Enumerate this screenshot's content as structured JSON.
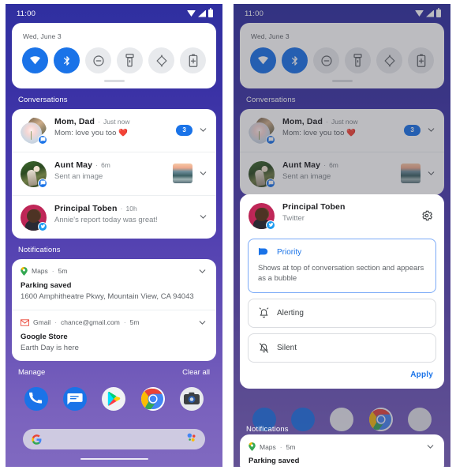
{
  "status_bar": {
    "time": "11:00",
    "icons": [
      "wifi-icon",
      "signal-icon",
      "battery-icon"
    ]
  },
  "quick_settings": {
    "date": "Wed, June 3",
    "tiles": [
      {
        "name": "wifi",
        "label": "Wi-Fi",
        "active": true
      },
      {
        "name": "bluetooth",
        "label": "Bluetooth",
        "active": true
      },
      {
        "name": "dnd",
        "label": "Do Not Disturb",
        "active": false
      },
      {
        "name": "flashlight",
        "label": "Flashlight",
        "active": false
      },
      {
        "name": "auto-rotate",
        "label": "Auto-rotate",
        "active": false
      },
      {
        "name": "battery-saver",
        "label": "Battery Saver",
        "active": false
      }
    ]
  },
  "sections": {
    "conversations": "Conversations",
    "notifications": "Notifications"
  },
  "conversations": [
    {
      "name": "Mom, Dad",
      "separator": "·",
      "time": "Just now",
      "message": "Mom: love you too ❤️",
      "count": "3",
      "badge": "messages-icon",
      "chevron": "chevron-down-icon"
    },
    {
      "name": "Aunt May",
      "separator": "·",
      "time": "6m",
      "message": "Sent an image",
      "thumbnail": "landscape-thumbnail",
      "badge": "messages-icon",
      "chevron": "chevron-down-icon"
    },
    {
      "name": "Principal Toben",
      "separator": "·",
      "time": "10h",
      "message": "Annie's report today was great!",
      "badge": "twitter-icon",
      "chevron": "chevron-down-icon"
    }
  ],
  "notifications": [
    {
      "app": "Maps",
      "app_icon": "maps-pin-icon",
      "sep1": "·",
      "time": "5m",
      "title": "Parking saved",
      "text": "1600 Amphitheatre Pkwy, Mountain View, CA 94043",
      "chevron": "chevron-down-icon"
    },
    {
      "app": "Gmail",
      "app_icon": "gmail-icon",
      "sep1": "·",
      "account": "chance@gmail.com",
      "sep2": "·",
      "time": "5m",
      "title": "Google Store",
      "text": "Earth Day is here",
      "chevron": "chevron-down-icon"
    }
  ],
  "shade_footer": {
    "manage": "Manage",
    "clear_all": "Clear all"
  },
  "dock": {
    "apps": [
      "phone-icon",
      "messages-icon",
      "play-store-icon",
      "chrome-icon",
      "camera-icon"
    ],
    "search": {
      "logo": "google-g-icon",
      "assistant": "assistant-icon",
      "placeholder": ""
    }
  },
  "dialog": {
    "header": {
      "name": "Principal Toben",
      "app": "Twitter",
      "settings_icon": "gear-icon",
      "badge": "twitter-icon"
    },
    "options": [
      {
        "id": "priority",
        "label": "Priority",
        "icon": "priority-flag-icon",
        "selected": true,
        "description": "Shows at top of conversation section and appears as a bubble"
      },
      {
        "id": "alerting",
        "label": "Alerting",
        "icon": "bell-ring-icon",
        "selected": false,
        "description": ""
      },
      {
        "id": "silent",
        "label": "Silent",
        "icon": "bell-off-icon",
        "selected": false,
        "description": ""
      }
    ],
    "apply_label": "Apply"
  },
  "colors": {
    "accent": "#1a73e8",
    "status_bar": "#2f2fa0",
    "shade_top": "#2f2fa0",
    "shade_bottom": "#7a62bd",
    "card": "#ffffff",
    "twitter": "#1d9bf0"
  }
}
